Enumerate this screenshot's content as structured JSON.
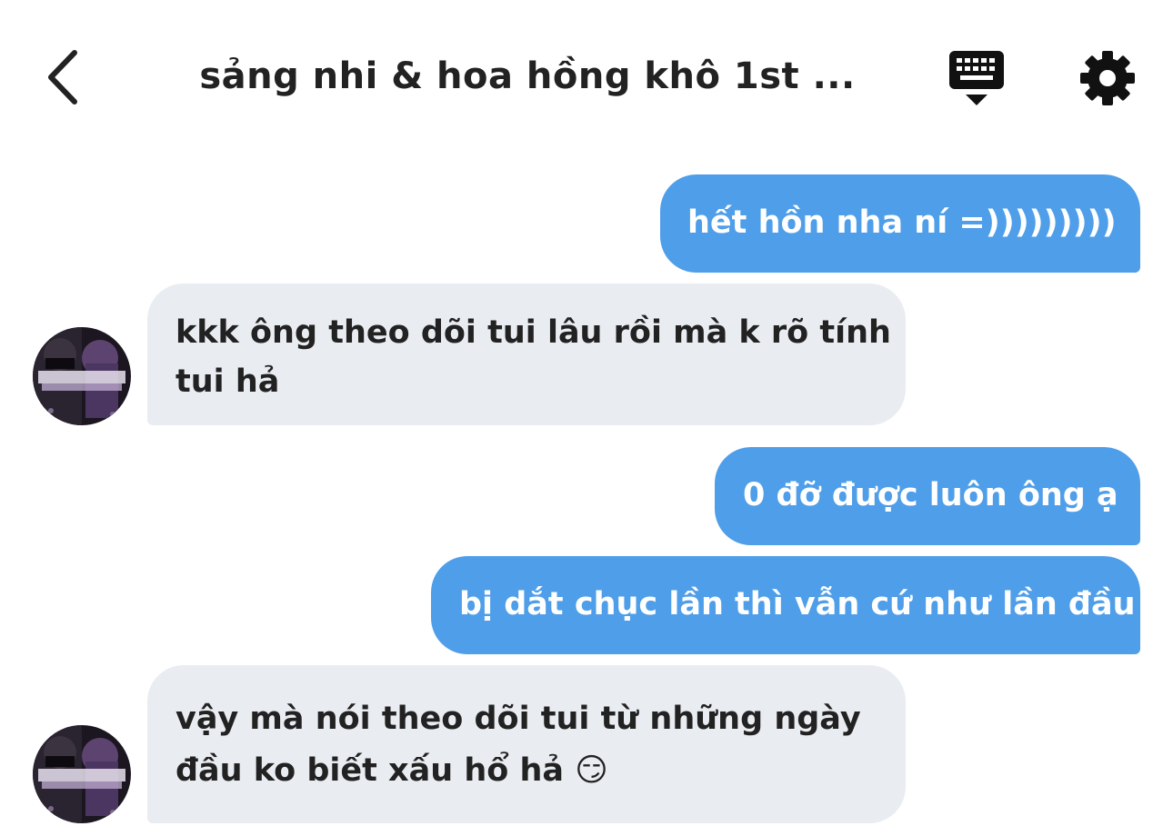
{
  "header": {
    "title": "sảng nhi & hoa hồng khô 1st ...",
    "back_icon": "chevron-left-icon",
    "keyboard_icon": "keyboard-icon",
    "settings_icon": "gear-icon"
  },
  "messages": [
    {
      "side": "sent",
      "text": "hết hồn nha ní =)))))))))"
    },
    {
      "side": "received",
      "lines": [
        "kkk ông theo dõi tui lâu rồi mà k rõ tính",
        "tui hả"
      ]
    },
    {
      "side": "sent",
      "text": "0 đỡ được luôn ông ạ"
    },
    {
      "side": "sent",
      "text": "bị dắt chục lần thì vẫn cứ như lần đầu"
    },
    {
      "side": "received",
      "lines": [
        "vậy mà nói theo dõi tui từ những ngày",
        "đầu ko biết xấu hổ hả 😏"
      ]
    }
  ],
  "colors": {
    "sent_bubble": "#4f9ee9",
    "received_bubble": "#e9ecf1",
    "text_dark": "#222222"
  }
}
